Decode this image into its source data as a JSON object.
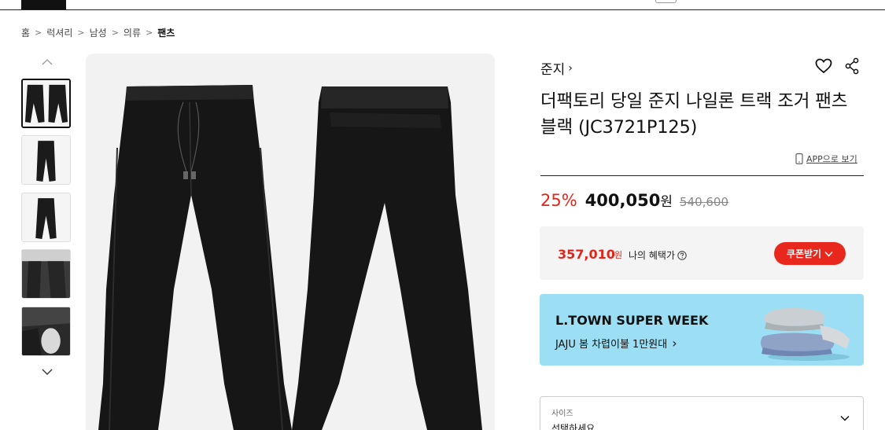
{
  "breadcrumb": [
    "홈",
    "럭셔리",
    "남성",
    "의류",
    "팬츠"
  ],
  "thumbnails": {
    "up_icon": "chevron-up-icon",
    "down_icon": "chevron-down-icon",
    "count": 5,
    "active_index": 0
  },
  "product": {
    "brand": "준지",
    "brand_chevron": "›",
    "title": "더팩토리 당일 준지 나일론 트랙 조거 팬츠 블랙 (JC3721P125)",
    "app_view_label": "APP으로 보기"
  },
  "price": {
    "discount": "25%",
    "sale_price": "400,050",
    "unit": "원",
    "original_price": "540,600"
  },
  "benefit": {
    "price": "357,010",
    "unit": "원",
    "label": "나의 혜택가",
    "coupon_button": "쿠폰받기"
  },
  "banner": {
    "title": "L.TOWN SUPER WEEK",
    "subtitle": "JAJU 봄 차렵이불 1만원대",
    "chevron": "›"
  },
  "options": {
    "size_label": "사이즈",
    "size_placeholder": "선택하세요"
  },
  "colors": {
    "accent_red": "#e0261a",
    "banner_bg": "#9cdff5"
  }
}
